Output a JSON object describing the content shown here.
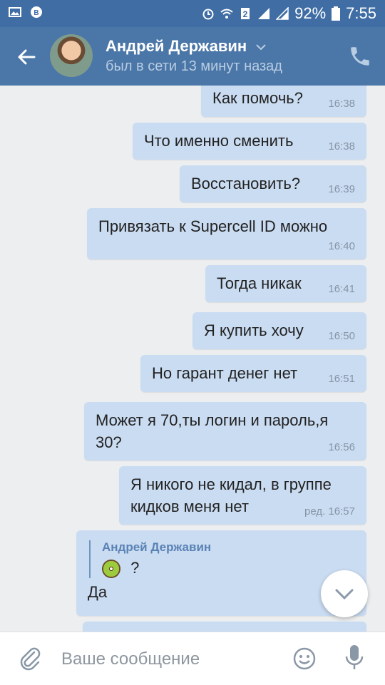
{
  "status_bar": {
    "battery_percent": "92%",
    "time": "7:55",
    "icons": [
      "image-icon",
      "vk-icon",
      "alarm-icon",
      "wifi-icon",
      "sim-icon",
      "signal-icon",
      "battery-icon"
    ]
  },
  "header": {
    "contact_name": "Андрей Державин",
    "contact_status": "был в сети 13 минут назад"
  },
  "messages": [
    {
      "text": "Как помочь?",
      "time": "16:38"
    },
    {
      "text": "Что именно сменить",
      "time": "16:38"
    },
    {
      "text": "Восстановить?",
      "time": "16:39"
    },
    {
      "text": "Привязать к Supercell ID можно",
      "time": "16:40"
    },
    {
      "text": "Тогда никак",
      "time": "16:41"
    },
    {
      "text": "Я купить хочу",
      "time": "16:50"
    },
    {
      "text": "Но гарант денег нет",
      "time": "16:51"
    },
    {
      "text": "Может я 70,ты логин и пароль,я 30?",
      "time": "16:56"
    },
    {
      "text": "Я никого не кидал, в группе кидков меня нет",
      "time": "ред. 16:57"
    }
  ],
  "reply_message": {
    "quoted_author": "Андрей Державин",
    "quoted_text": "?",
    "text": "Да"
  },
  "composer": {
    "placeholder": "Ваше сообщение"
  },
  "colors": {
    "header": "#4a76a8",
    "status_bar": "#3f6da4",
    "bubble": "#cadcf2",
    "background": "#edeef0"
  }
}
